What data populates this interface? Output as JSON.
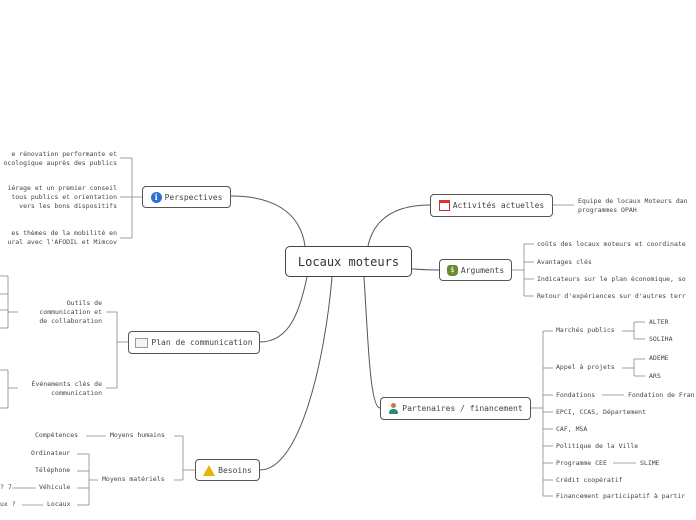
{
  "center": "Locaux moteurs",
  "perspectives": {
    "title": "Perspectives",
    "icon": "info-icon",
    "items": [
      [
        "e rénovation performante et",
        "ocologique auprès des publics"
      ],
      [
        "iérage et un premier conseil",
        "tous publics et orientation",
        "vers les bons dispositifs"
      ],
      [
        "es thèmes de la mobilité en",
        "ural avec l'AFODIL et Mimcov"
      ]
    ]
  },
  "activites": {
    "title": "Activités actuelles",
    "icon": "calendar-icon",
    "items": [
      [
        "Equipe de locaux Moteurs dan",
        "programmes OPAH"
      ]
    ]
  },
  "arguments": {
    "title": "Arguments",
    "icon": "money-bag-icon",
    "items": [
      "coûts des locaux moteurs et coordinate",
      "Avantages clés",
      "Indicateurs sur le plan économique, so",
      "Retour d'expériences sur d'autres terr"
    ]
  },
  "communication": {
    "title": "Plan de communication",
    "icon": "envelope-icon",
    "outils": [
      "Outils de",
      "communication et",
      "de collaboration"
    ],
    "evenements": [
      "Événements clés de",
      "communication"
    ]
  },
  "besoins": {
    "title": "Besoins",
    "icon": "warning-icon",
    "humains": "Moyens humains",
    "competences": "Compétences",
    "materiels": "Moyens matériels",
    "ordinateur": "Ordinateur",
    "telephone": "Téléphone",
    "vehicule": "Véhicule",
    "vehicule_q": "? 7",
    "locaux": "Locaux",
    "locaux_q": "ux ?"
  },
  "partenaires": {
    "title": "Partenaires / financement",
    "icon": "person-icon",
    "marches": "Marchés publics",
    "alter": "ALTER",
    "soliha": "SOLIHA",
    "appel": "Appel à projets",
    "ademe": "ADEME",
    "ars": "ARS",
    "fondations": "Fondations",
    "fondation_fr": "Fondation de Fran",
    "epci": "EPCI, CCAS, Département",
    "caf": "CAF, MSA",
    "politique": "Politique de la Ville",
    "cee": "Programme CEE",
    "slime": "SLIME",
    "credit": "Crédit coopératif",
    "participatif": "Financement participatif à partir"
  }
}
